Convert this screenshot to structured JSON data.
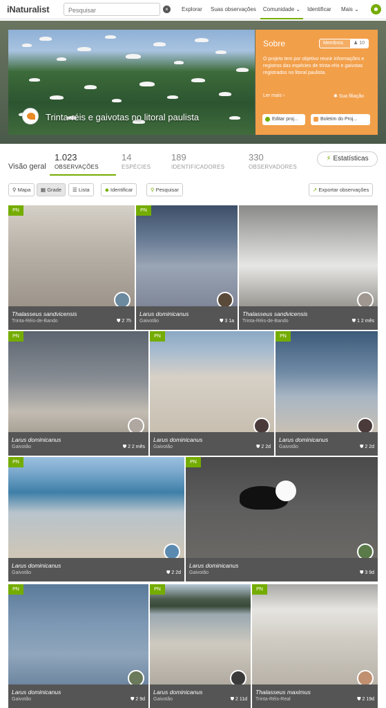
{
  "header": {
    "logo": "iNaturalist",
    "search_placeholder": "Pesquisar",
    "nav": [
      "Explorar",
      "Suas observações",
      "Comunidade ⌄",
      "Identificar",
      "Mais ⌄"
    ]
  },
  "project": {
    "title": "Trinta-réis e gaivotas no litoral paulista",
    "about": {
      "heading": "Sobre",
      "members_label": "Membros",
      "members_count": "10",
      "description": "O projeto tem por objetivo reunir informações e registros das espécies de trinta-réis e gaivotas registrados no litoral paulista.",
      "more": "Ler mais ›",
      "membership": "Sua filiação",
      "edit": "Editar proj...",
      "journal": "Boletim do Proj..."
    }
  },
  "stats": {
    "overview": "Visão geral",
    "items": [
      {
        "num": "1.023",
        "label": "OBSERVAÇÕES"
      },
      {
        "num": "14",
        "label": "ESPÉCIES"
      },
      {
        "num": "189",
        "label": "IDENTIFICADORES"
      },
      {
        "num": "330",
        "label": "OBSERVADORES"
      }
    ],
    "button": "Estatísticas"
  },
  "toolbar": {
    "map": "Mapa",
    "grid": "Grade",
    "list": "Lista",
    "identify": "Identificar",
    "search": "Pesquisar",
    "export": "Exportar observações"
  },
  "observations": [
    {
      "badge": "PN",
      "taxon": "Thalasseus sandvicensis",
      "common": "Trinta-Réis-de-Bando",
      "meta": "2  7h"
    },
    {
      "badge": "PN",
      "taxon": "Larus dominicanus",
      "common": "Gaivotão",
      "meta": "3  1a"
    },
    {
      "badge": "",
      "taxon": "Thalasseus sandvicensis",
      "common": "Trinta-Réis-de-Bando",
      "meta": "1  2 mês"
    },
    {
      "badge": "PN",
      "taxon": "Larus dominicanus",
      "common": "Gaivotão",
      "meta": "2  2 mês"
    },
    {
      "badge": "PN",
      "taxon": "Larus dominicanus",
      "common": "Gaivotão",
      "meta": "2  2d"
    },
    {
      "badge": "PN",
      "taxon": "Larus dominicanus",
      "common": "Gaivotão",
      "meta": "2  2d"
    },
    {
      "badge": "PN",
      "taxon": "Larus dominicanus",
      "common": "Gaivotão",
      "meta": "2  2d"
    },
    {
      "badge": "PN",
      "taxon": "Larus dominicanus",
      "common": "Gaivotão",
      "meta": "3  9d"
    },
    {
      "badge": "PN",
      "taxon": "Larus dominicanus",
      "common": "Gaivotão",
      "meta": "2  9d"
    },
    {
      "badge": "PN",
      "taxon": "Larus dominicanus",
      "common": "Gaivotão",
      "meta": "2  11d"
    },
    {
      "badge": "PN",
      "taxon": "Thalasseus maximus",
      "common": "Trinta-Réis-Real",
      "meta": "2  19d"
    }
  ],
  "colors": {
    "brand": "#74ac00",
    "about_bg": "#f29f4a",
    "caption_bg": "#555555"
  }
}
